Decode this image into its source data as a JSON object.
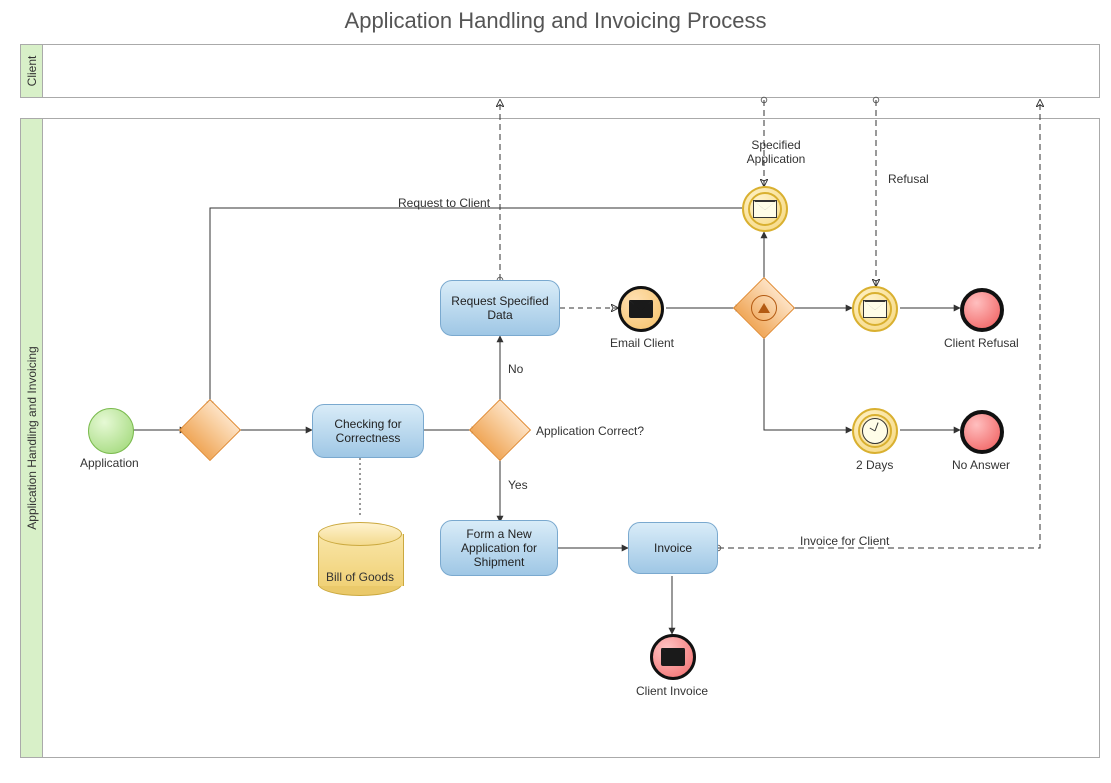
{
  "title": "Application Handling and Invoicing Process",
  "lanes": {
    "client": "Client",
    "main": "Application Handling and Invoicing"
  },
  "nodes": {
    "start": "Application",
    "checkCorrectness": "Checking for Correctness",
    "requestData": "Request Specified Data",
    "formShipment": "Form a New Application for Shipment",
    "invoice": "Invoice",
    "emailClient": "Email Client",
    "billOfGoods": "Bill of Goods",
    "twoDays": "2 Days",
    "clientRefusal": "Client Refusal",
    "noAnswer": "No Answer",
    "clientInvoice": "Client Invoice"
  },
  "edges": {
    "appCorrect": "Application Correct?",
    "no": "No",
    "yes": "Yes",
    "requestToClient": "Request to Client",
    "specifiedApp": "Specified Application",
    "refusal": "Refusal",
    "invoiceForClient": "Invoice for Client"
  }
}
